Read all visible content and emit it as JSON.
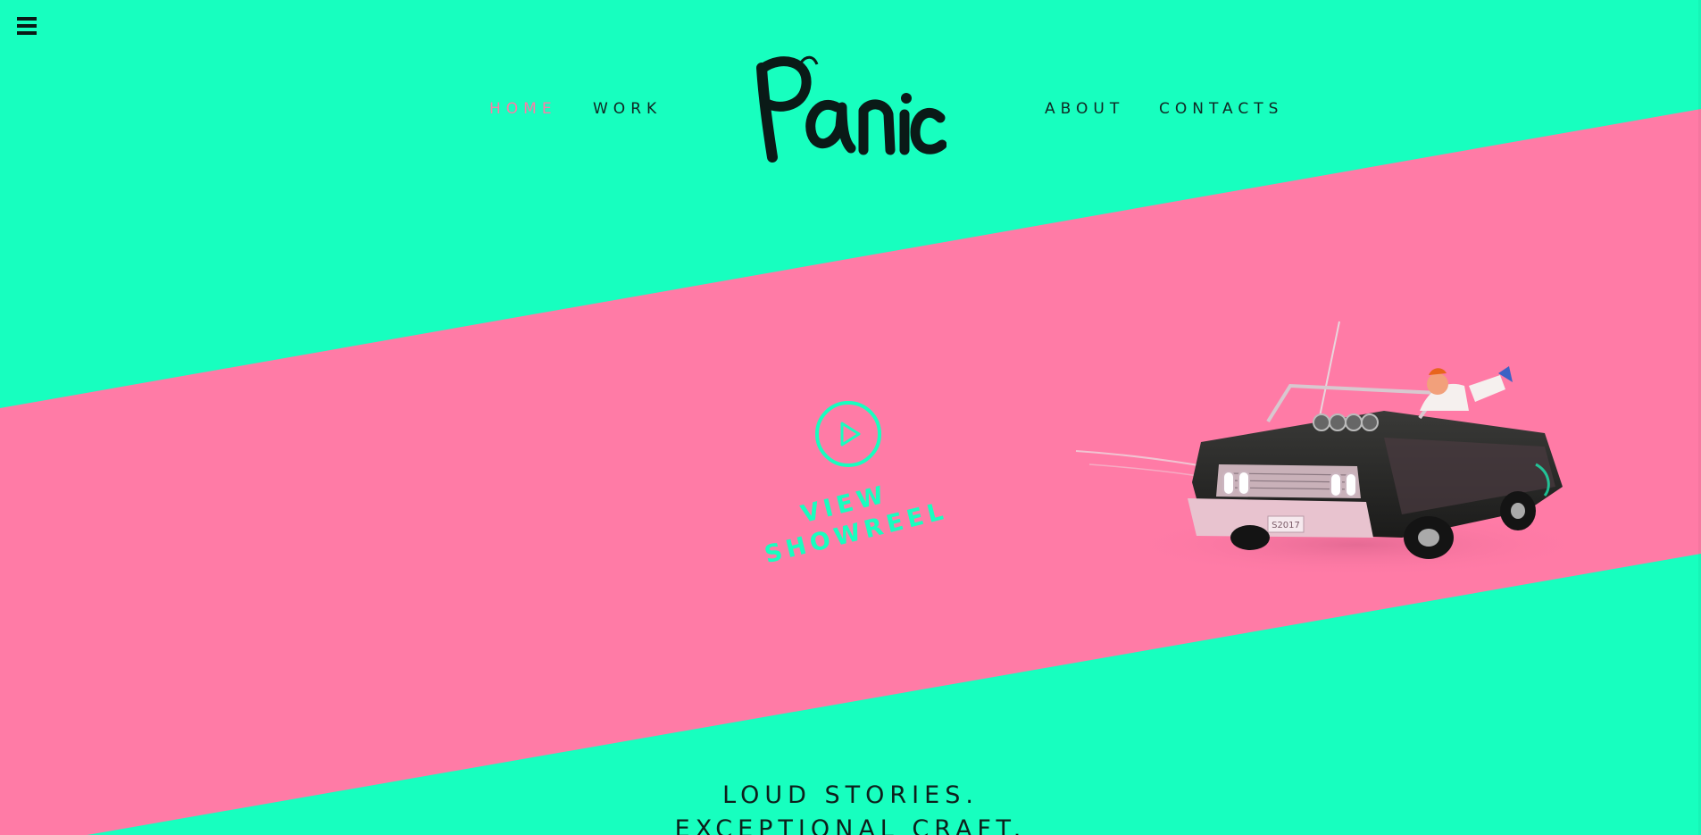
{
  "header": {
    "menu_icon": "hamburger-icon",
    "logo_text": "Panic",
    "nav": {
      "home": "HOME",
      "work": "WORK",
      "about": "ABOUT",
      "contacts": "CONTACTS"
    },
    "active_item": "home"
  },
  "hero": {
    "play_icon": "play-icon",
    "showreel_line1": "VIEW",
    "showreel_line2": "SHOWREEL",
    "plate_text": "S2017"
  },
  "tagline": {
    "line1": "LOUD STORIES.",
    "line2": "EXCEPTIONAL CRAFT."
  },
  "colors": {
    "mint": "#17ffbf",
    "pink": "#ff7ba6",
    "ink": "#0d1f1b"
  }
}
